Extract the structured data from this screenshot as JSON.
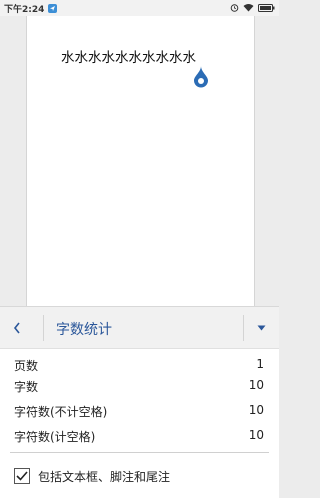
{
  "status_bar": {
    "time": "下午2:24",
    "icons": [
      "app-notification-icon",
      "alarm-icon",
      "wifi-icon",
      "battery-icon"
    ]
  },
  "document": {
    "content": "水水水水水水水水水水"
  },
  "word_count_panel": {
    "title": "字数统计",
    "stats": [
      {
        "label": "页数",
        "value": "1"
      },
      {
        "label": "字数",
        "value": "10"
      },
      {
        "label": "字符数(不计空格)",
        "value": "10"
      },
      {
        "label": "字符数(计空格)",
        "value": "10"
      }
    ],
    "include_option": {
      "label": "包括文本框、脚注和尾注",
      "checked": true
    }
  },
  "colors": {
    "accent": "#2b579a",
    "handle": "#2b6cb5"
  }
}
